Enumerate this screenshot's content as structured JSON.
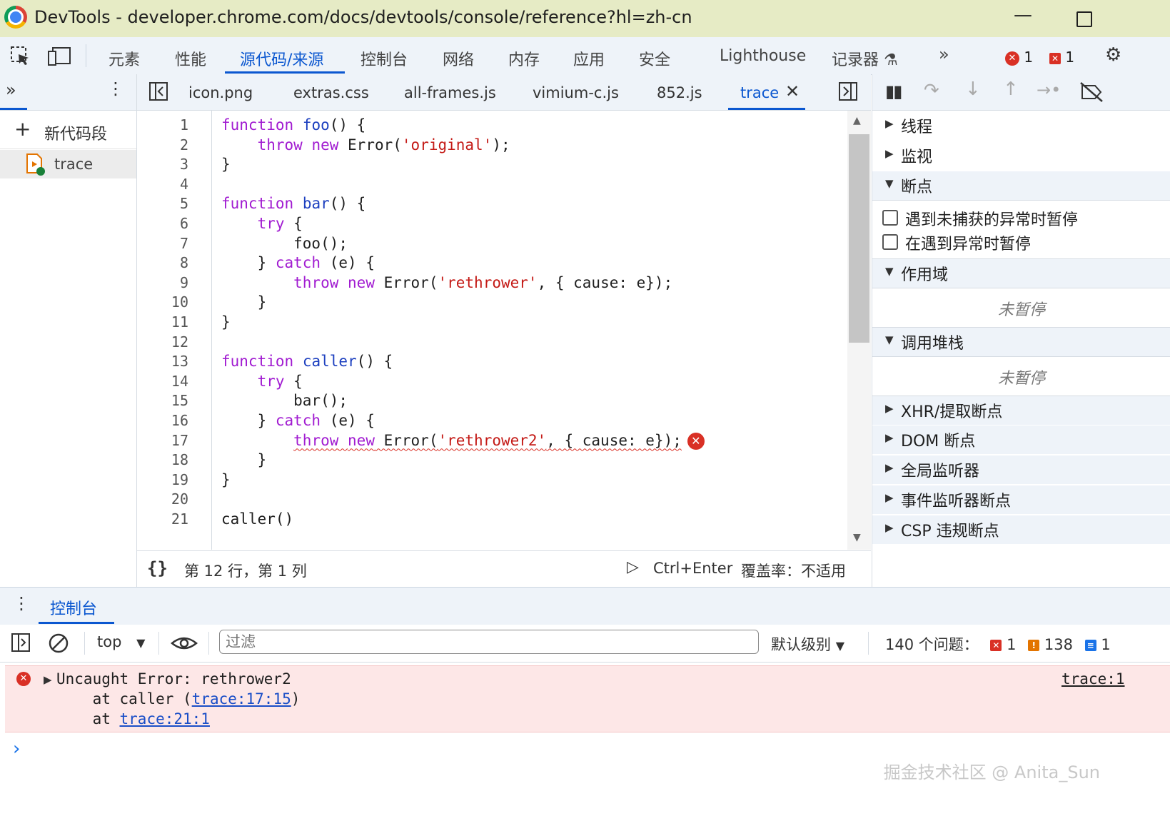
{
  "window": {
    "title": "DevTools - developer.chrome.com/docs/devtools/console/reference?hl=zh-cn"
  },
  "main_tabs": [
    "元素",
    "性能",
    "源代码/来源",
    "控制台",
    "网络",
    "内存",
    "应用",
    "安全",
    "Lighthouse",
    "记录器 ⚗"
  ],
  "main_tabs_active": "源代码/来源",
  "issue_counts": {
    "errors": "1",
    "issues": "1"
  },
  "navigator": {
    "new_snippet": "新代码段",
    "snippet_name": "trace"
  },
  "editor_tabs": [
    "icon.png",
    "extras.css",
    "all-frames.js",
    "vimium-c.js",
    "852.js",
    "trace"
  ],
  "editor_active_tab": "trace",
  "code": {
    "lines": [
      "function foo() {",
      "    throw new Error('original');",
      "}",
      "",
      "function bar() {",
      "    try {",
      "        foo();",
      "    } catch (e) {",
      "        throw new Error('rethrower', { cause: e});",
      "    }",
      "}",
      "",
      "function caller() {",
      "    try {",
      "        bar();",
      "    } catch (e) {",
      "        throw new Error('rethrower2', { cause: e});",
      "    }",
      "}",
      "",
      "caller()"
    ],
    "error_line": 17
  },
  "status_bar": {
    "position": "第 12 行，第 1 列",
    "run_shortcut": "Ctrl+Enter",
    "coverage": "覆盖率：不适用"
  },
  "debugger": {
    "threads": "线程",
    "watch": "监视",
    "breakpoints": "断点",
    "pause_uncaught": "遇到未捕获的异常时暂停",
    "pause_caught": "在遇到异常时暂停",
    "scope": "作用域",
    "not_paused": "未暂停",
    "call_stack": "调用堆栈",
    "xhr_breakpoints": "XHR/提取断点",
    "dom_breakpoints": "DOM 断点",
    "global_listeners": "全局监听器",
    "event_listener_breakpoints": "事件监听器断点",
    "csp_breakpoints": "CSP 违规断点"
  },
  "drawer": {
    "tab": "控制台"
  },
  "console": {
    "context": "top",
    "filter_placeholder": "过滤",
    "level": "默认级别",
    "issues_label": "140 个问题：",
    "issues_error": "1",
    "issues_warning": "138",
    "issues_info": "1",
    "error": {
      "line1": "Uncaught Error: rethrower2",
      "line2_prefix": "    at caller (",
      "line2_link": "trace:17:15",
      "line2_suffix": ")",
      "line3_prefix": "    at ",
      "line3_link": "trace:21:1",
      "source_link": "trace:1"
    },
    "prompt": "›"
  },
  "watermark": "掘金技术社区 @ Anita_Sun",
  "colors": {
    "accent": "#0b57d0",
    "error": "#d93025",
    "error_bg": "#fde7e7",
    "titlebar": "#e6ebc5"
  }
}
